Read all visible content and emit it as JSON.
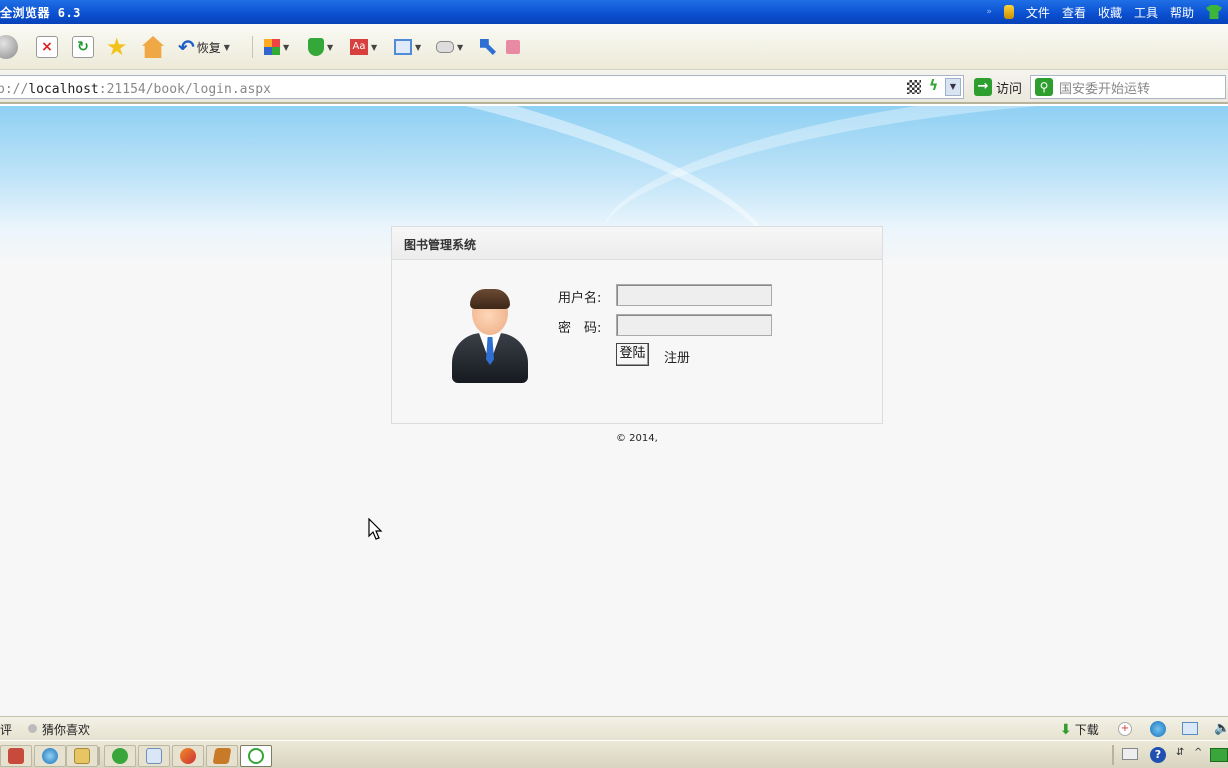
{
  "browser": {
    "title": "全浏览器 6.3",
    "menu": [
      "文件",
      "查看",
      "收藏",
      "工具",
      "帮助"
    ],
    "toolbar": {
      "restore_label": "恢复"
    },
    "address": {
      "prefix": "p://",
      "host": "localhost",
      "rest": ":21154/book/login.aspx"
    },
    "visit_label": "访问",
    "search_text": "国安委开始运转"
  },
  "login": {
    "title": "图书管理系统",
    "username_label": "用户名:",
    "password_label": "密　码:",
    "username_value": "",
    "password_value": "",
    "login_button": "登陆",
    "register_link": "注册",
    "copyright": "© 2014,"
  },
  "status": {
    "left_fragment": "评",
    "guess_label": "猜你喜欢",
    "download_label": "下载"
  },
  "colors": {
    "titlebar": "#0a4fd0",
    "sky": "#8fd0f3",
    "page_bg": "#f7f7f7"
  }
}
